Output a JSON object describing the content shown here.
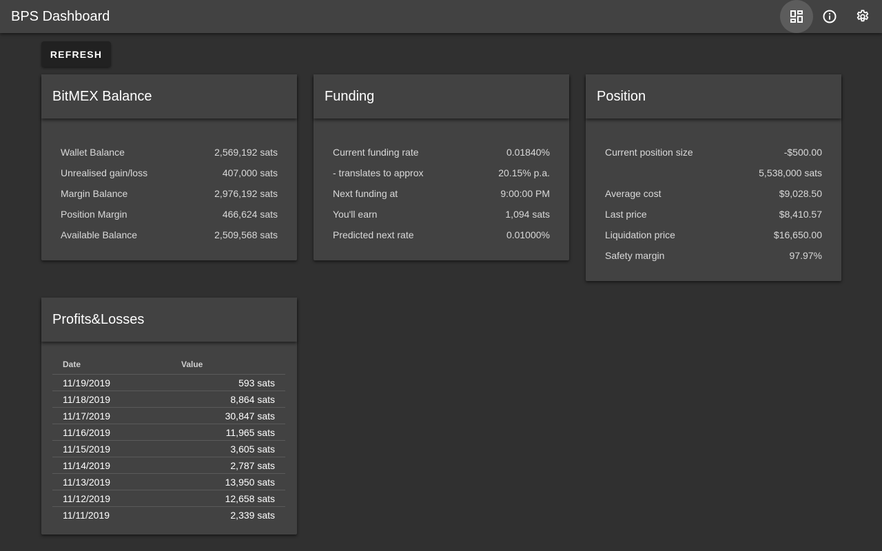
{
  "app": {
    "title": "BPS Dashboard",
    "icons": [
      "dashboard-icon",
      "info-icon",
      "settings-icon"
    ]
  },
  "toolbar": {
    "refresh_label": "REFRESH"
  },
  "balance": {
    "title": "BitMEX Balance",
    "rows": [
      {
        "label": "Wallet Balance",
        "value": "2,569,192 sats"
      },
      {
        "label": "Unrealised gain/loss",
        "value": "407,000 sats"
      },
      {
        "label": "Margin Balance",
        "value": "2,976,192 sats"
      },
      {
        "label": "Position Margin",
        "value": "466,624 sats"
      },
      {
        "label": "Available Balance",
        "value": "2,509,568 sats"
      }
    ]
  },
  "funding": {
    "title": "Funding",
    "rows": [
      {
        "label": "Current funding rate",
        "value": "0.01840%"
      },
      {
        "label": "- translates to approx",
        "value": "20.15% p.a."
      },
      {
        "label": "Next funding at",
        "value": "9:00:00 PM"
      },
      {
        "label": "You'll earn",
        "value": "1,094 sats"
      },
      {
        "label": "Predicted next rate",
        "value": "0.01000%"
      }
    ]
  },
  "position": {
    "title": "Position",
    "rows": [
      {
        "label": "Current position size",
        "value": "-$500.00"
      },
      {
        "label": "",
        "value": "5,538,000 sats"
      },
      {
        "label": "Average cost",
        "value": "$9,028.50"
      },
      {
        "label": "Last price",
        "value": "$8,410.57"
      },
      {
        "label": "Liquidation price",
        "value": "$16,650.00"
      },
      {
        "label": "Safety margin",
        "value": "97.97%"
      }
    ]
  },
  "pnl": {
    "title": "Profits&Losses",
    "columns": {
      "date": "Date",
      "value": "Value"
    },
    "rows": [
      {
        "date": "11/19/2019",
        "value": "593 sats"
      },
      {
        "date": "11/18/2019",
        "value": "8,864 sats"
      },
      {
        "date": "11/17/2019",
        "value": "30,847 sats"
      },
      {
        "date": "11/16/2019",
        "value": "11,965 sats"
      },
      {
        "date": "11/15/2019",
        "value": "3,605 sats"
      },
      {
        "date": "11/14/2019",
        "value": "2,787 sats"
      },
      {
        "date": "11/13/2019",
        "value": "13,950 sats"
      },
      {
        "date": "11/12/2019",
        "value": "12,658 sats"
      },
      {
        "date": "11/11/2019",
        "value": "2,339 sats"
      }
    ]
  },
  "colors": {
    "background": "#303030",
    "surface": "#424242",
    "button": "#212121",
    "active_icon_bg": "#5c5c5c"
  }
}
